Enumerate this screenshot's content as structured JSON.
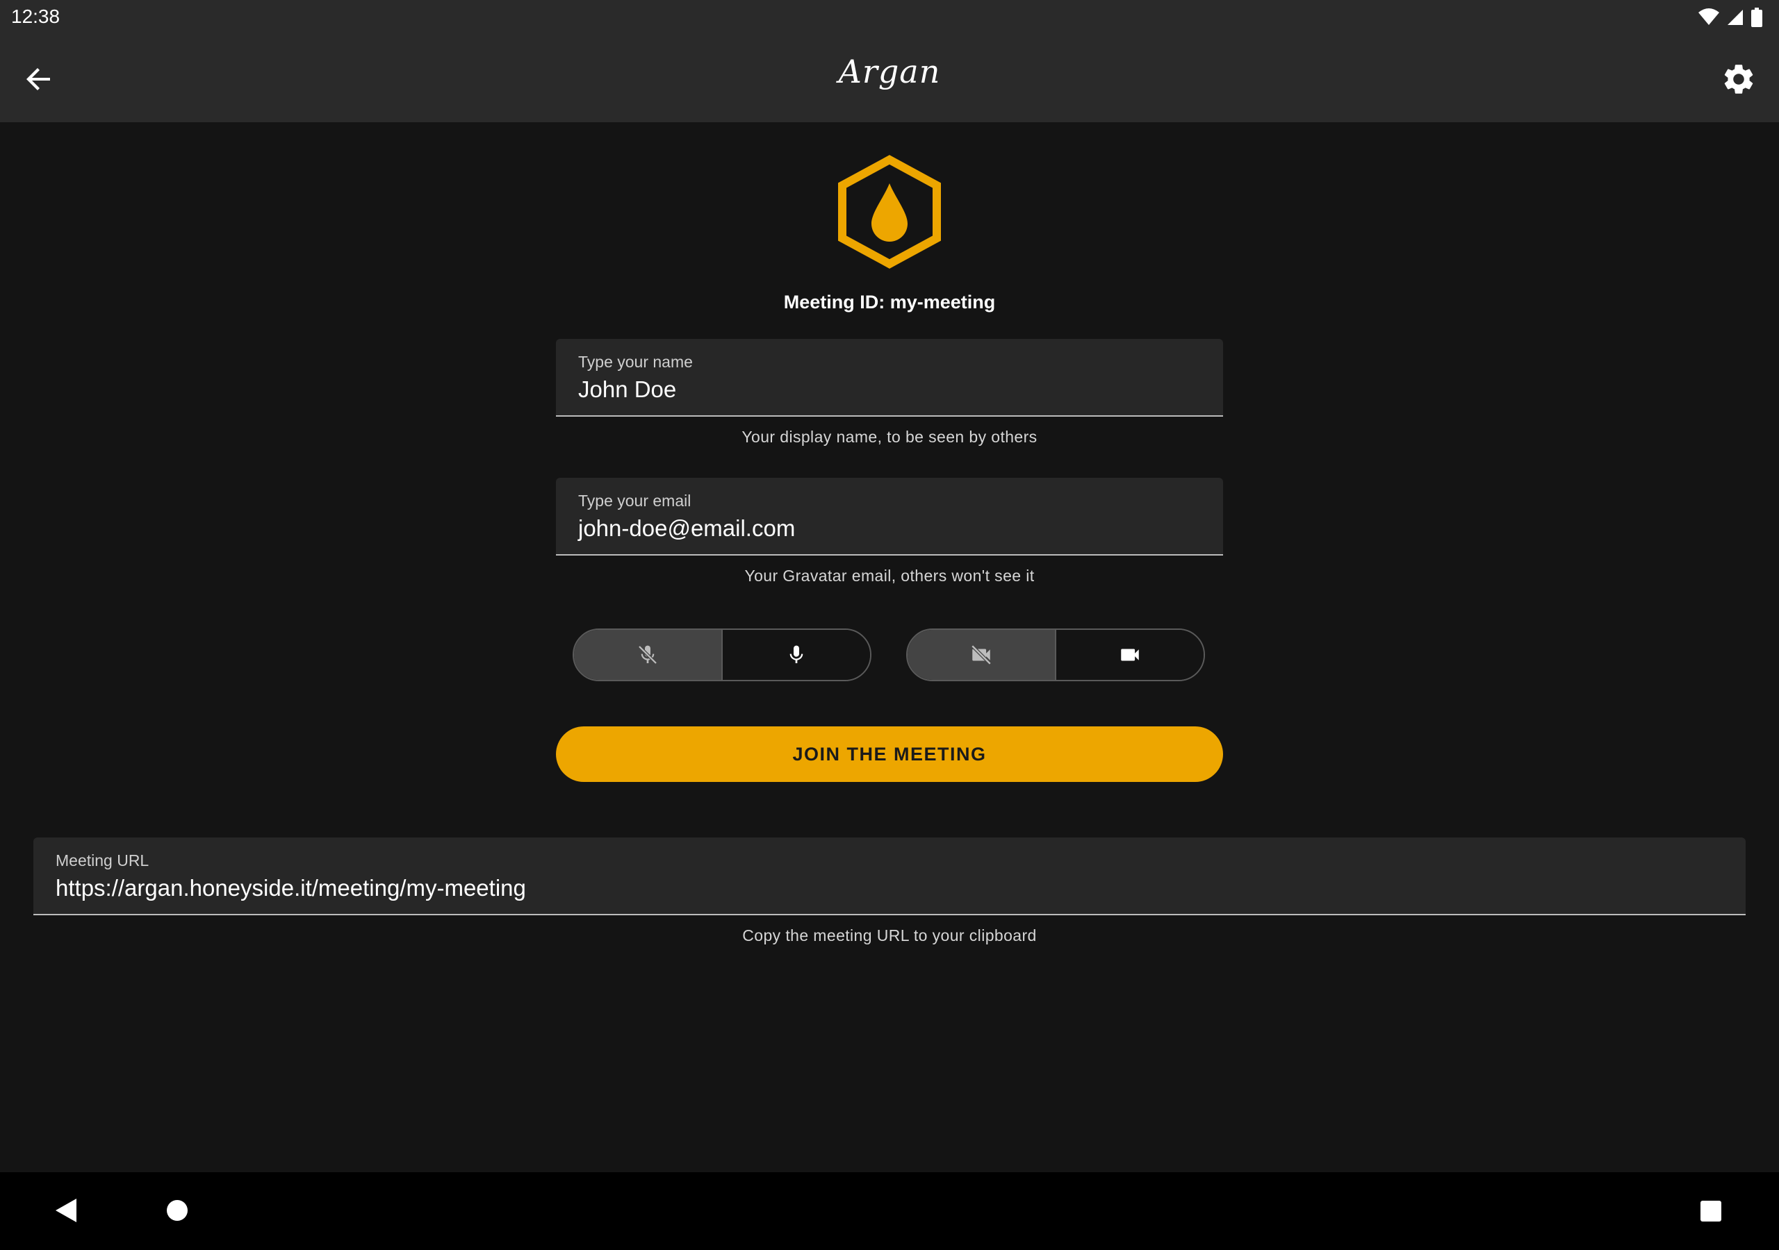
{
  "status_bar": {
    "time": "12:38",
    "icons": [
      "wifi-icon",
      "signal-icon",
      "battery-icon"
    ]
  },
  "app_bar": {
    "title": "Argan",
    "back_icon": "arrow-back-icon",
    "settings_icon": "gear-icon"
  },
  "logo": {
    "icon": "hexagon-drop-logo",
    "color": "#eda600"
  },
  "meeting": {
    "id_text": "Meeting ID: my-meeting"
  },
  "name_field": {
    "label": "Type your name",
    "value": "John Doe",
    "helper": "Your display name, to be seen by others"
  },
  "email_field": {
    "label": "Type your email",
    "value": "john-doe@email.com",
    "helper": "Your Gravatar email, others won't see it"
  },
  "audio_toggle": {
    "options": [
      {
        "icon": "mic-off-icon",
        "selected": true
      },
      {
        "icon": "mic-icon",
        "selected": false
      }
    ]
  },
  "video_toggle": {
    "options": [
      {
        "icon": "videocam-off-icon",
        "selected": true
      },
      {
        "icon": "videocam-icon",
        "selected": false
      }
    ]
  },
  "join_button": {
    "label": "JOIN THE MEETING",
    "color": "#eda600"
  },
  "url_field": {
    "label": "Meeting URL",
    "value": "https://argan.honeyside.it/meeting/my-meeting",
    "helper": "Copy the meeting URL to your clipboard"
  },
  "nav_bar": {
    "buttons": [
      "nav-back-icon",
      "nav-home-icon",
      "nav-recents-icon"
    ]
  },
  "colors": {
    "accent": "#eda600",
    "background": "#141414",
    "app_bar": "#2a2a2a"
  }
}
